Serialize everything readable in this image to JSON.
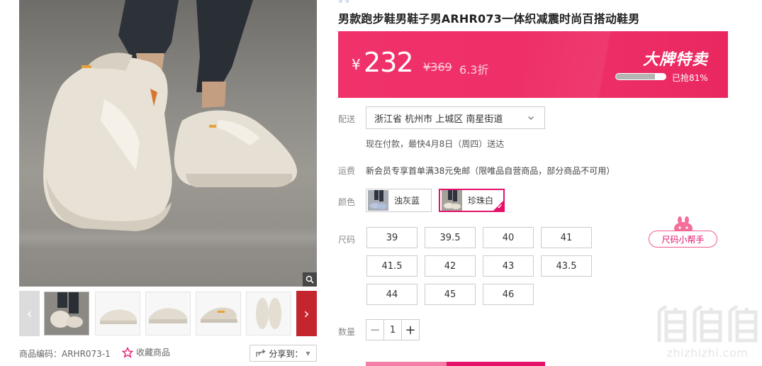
{
  "top_tag": "g g",
  "product": {
    "title": "男款跑步鞋男鞋子男ARHR073一体织减震时尚百搭动鞋男",
    "code_text": "商品编码：ARHR073-1",
    "favorite_label": "收藏商品",
    "share_label": "分享到："
  },
  "price": {
    "currency": "¥",
    "current": "232",
    "original": "¥369",
    "discount": "6.3折",
    "sale_title": "大牌特卖",
    "sold_text": "已抢81%",
    "sold_fraction": 0.81
  },
  "delivery": {
    "label": "配送",
    "address": "浙江省 杭州市 上城区 南星街道",
    "time_text": "现在付款，最快4月8日（周四）送达"
  },
  "shipping": {
    "label": "运费",
    "text": "新会员专享首单满38元免邮（限唯品自营商品，部分商品不可用）"
  },
  "colors": {
    "label": "颜色",
    "options": [
      {
        "name": "浊灰蓝",
        "selected": false
      },
      {
        "name": "珍珠白",
        "selected": true
      }
    ]
  },
  "sizes": {
    "label": "尺码",
    "options": [
      "39",
      "39.5",
      "40",
      "41",
      "41.5",
      "42",
      "43",
      "43.5",
      "44",
      "45",
      "46"
    ],
    "helper_label": "尺码小帮手"
  },
  "quantity": {
    "label": "数量",
    "minus": "−",
    "value": "1",
    "plus": "+"
  },
  "watermark": {
    "text": "zhizhizhi.com"
  },
  "colors_theme": {
    "accent": "#e5116a",
    "banner": "#ee2f67"
  }
}
